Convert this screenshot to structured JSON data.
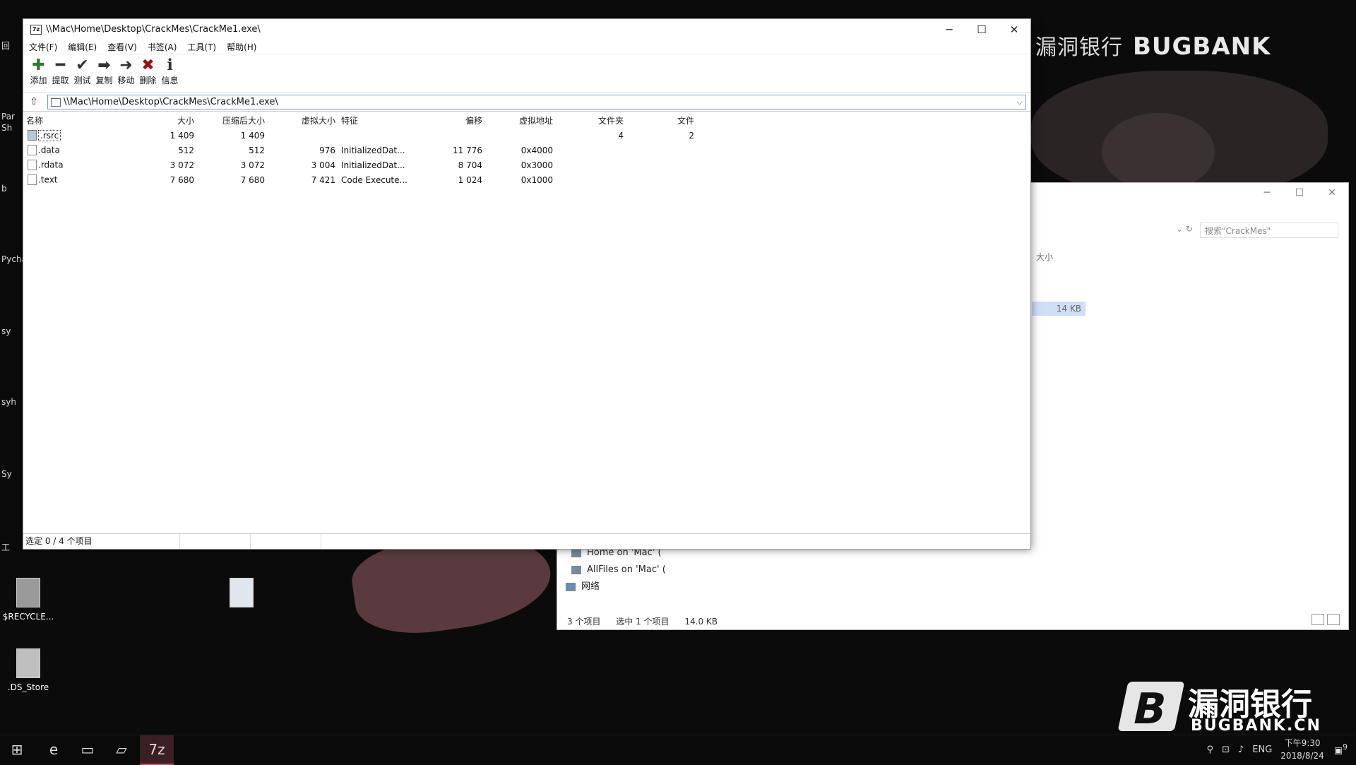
{
  "watermark_top": {
    "cn": "漏洞银行",
    "en": "BUGBANK"
  },
  "watermark_bottom": {
    "cn": "漏洞银行",
    "en": "BUGBANK.CN"
  },
  "desktop": {
    "icons": [
      {
        "label": "$RECYCLE..."
      },
      {
        "label": ".DS_Store"
      }
    ],
    "edge_labels": [
      "回",
      "Par",
      "Sh",
      "b",
      "Pycha",
      "sy",
      "syh",
      "Sy",
      "工"
    ]
  },
  "zip_window": {
    "title": "\\\\Mac\\Home\\Desktop\\CrackMes\\CrackMe1.exe\\",
    "caption": {
      "minimize": "─",
      "maximize": "☐",
      "close": "✕"
    },
    "menu": [
      "文件(F)",
      "编辑(E)",
      "查看(V)",
      "书签(A)",
      "工具(T)",
      "帮助(H)"
    ],
    "toolbar": [
      {
        "label": "添加",
        "icon": "add-icon",
        "glyph": "✚"
      },
      {
        "label": "提取",
        "icon": "extract-icon",
        "glyph": "━"
      },
      {
        "label": "测试",
        "icon": "test-icon",
        "glyph": "✔"
      },
      {
        "label": "复制",
        "icon": "copy-icon",
        "glyph": "➡"
      },
      {
        "label": "移动",
        "icon": "move-icon",
        "glyph": "➜"
      },
      {
        "label": "删除",
        "icon": "delete-icon",
        "glyph": "✖"
      },
      {
        "label": "信息",
        "icon": "info-icon",
        "glyph": "ℹ"
      }
    ],
    "address": "\\\\Mac\\Home\\Desktop\\CrackMes\\CrackMe1.exe\\",
    "columns": [
      "名称",
      "大小",
      "压缩后大小",
      "虚拟大小",
      "特征",
      "偏移",
      "虚拟地址",
      "文件夹",
      "文件"
    ],
    "rows": [
      {
        "name": ".rsrc",
        "type": "folder",
        "size": "1 409",
        "packed": "1 409",
        "vsize": "",
        "chars": "",
        "offset": "",
        "vaddr": "",
        "folders": "4",
        "files": "2"
      },
      {
        "name": ".data",
        "type": "file",
        "size": "512",
        "packed": "512",
        "vsize": "976",
        "chars": "InitializedDat...",
        "offset": "11 776",
        "vaddr": "0x4000",
        "folders": "",
        "files": ""
      },
      {
        "name": ".rdata",
        "type": "file",
        "size": "3 072",
        "packed": "3 072",
        "vsize": "3 004",
        "chars": "InitializedDat...",
        "offset": "8 704",
        "vaddr": "0x3000",
        "folders": "",
        "files": ""
      },
      {
        "name": ".text",
        "type": "file",
        "size": "7 680",
        "packed": "7 680",
        "vsize": "7 421",
        "chars": "Code Execute...",
        "offset": "1 024",
        "vaddr": "0x1000",
        "folders": "",
        "files": ""
      }
    ],
    "status": "选定 0 / 4 个项目"
  },
  "explorer": {
    "caption": {
      "minimize": "─",
      "maximize": "☐",
      "close": "✕"
    },
    "search_placeholder": "搜索\"CrackMes\"",
    "size_header": "大小",
    "size_value": "14 KB",
    "tree": [
      "Home on 'Mac' (",
      "AllFiles on 'Mac' (",
      "网络"
    ],
    "status": {
      "count": "3 个项目",
      "selected": "选中 1 个项目",
      "size": "14.0 KB"
    }
  },
  "taskbar": {
    "tray": {
      "lang": "ENG",
      "time": "下午9:30",
      "date": "2018/8/24",
      "notif": "9"
    }
  }
}
